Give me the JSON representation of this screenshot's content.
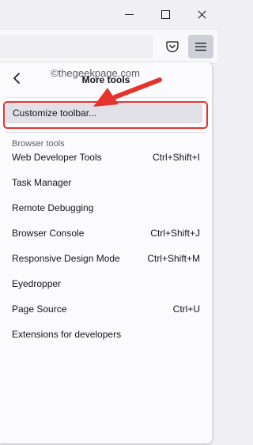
{
  "window_controls": {
    "minimize_icon": "minimize-icon",
    "maximize_icon": "maximize-icon",
    "close_icon": "close-icon"
  },
  "toolbar": {
    "pocket_icon": "pocket-icon",
    "menu_icon": "hamburger-menu-icon"
  },
  "panel": {
    "title": "More tools",
    "back_icon": "back-arrow-icon",
    "watermark": "©thegeekpage.com",
    "customize_label": "Customize toolbar...",
    "section_label": "Browser tools",
    "items": [
      {
        "label": "Web Developer Tools",
        "shortcut": "Ctrl+Shift+I"
      },
      {
        "label": "Task Manager",
        "shortcut": ""
      },
      {
        "label": "Remote Debugging",
        "shortcut": ""
      },
      {
        "label": "Browser Console",
        "shortcut": "Ctrl+Shift+J"
      },
      {
        "label": "Responsive Design Mode",
        "shortcut": "Ctrl+Shift+M"
      },
      {
        "label": "Eyedropper",
        "shortcut": ""
      },
      {
        "label": "Page Source",
        "shortcut": "Ctrl+U"
      },
      {
        "label": "Extensions for developers",
        "shortcut": ""
      }
    ]
  },
  "colors": {
    "highlight_border": "#e5322d",
    "arrow": "#e5322d",
    "menu_button_active": "#cfcfd8"
  }
}
